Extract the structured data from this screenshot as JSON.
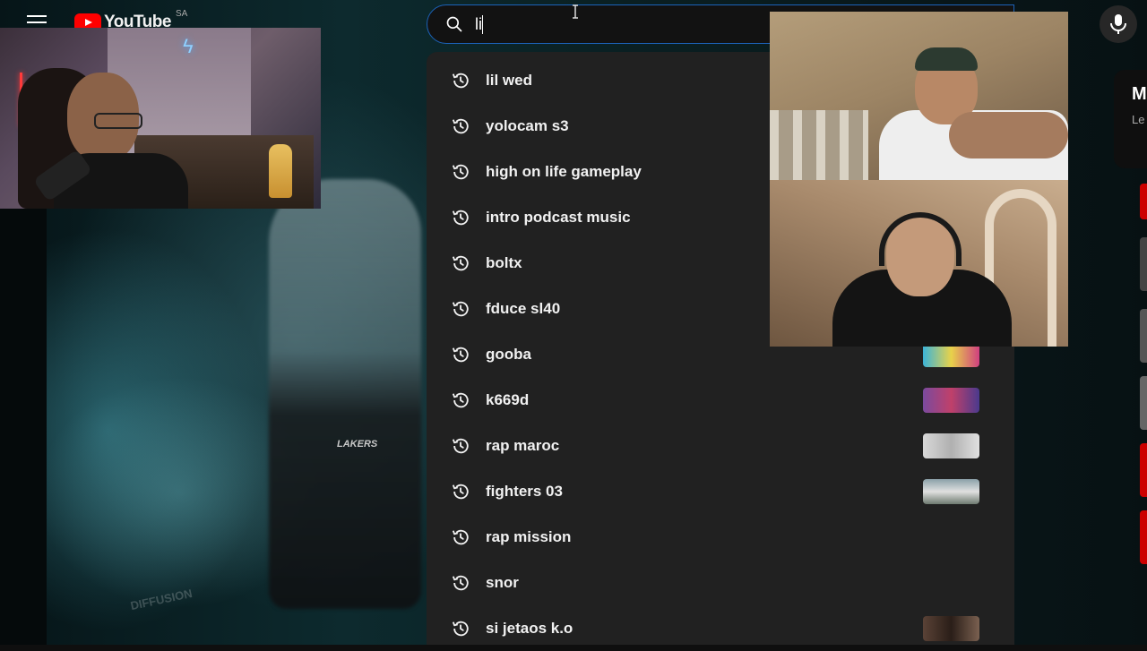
{
  "header": {
    "logo_text": "YouTube",
    "region": "SA",
    "menu_icon": "hamburger-icon"
  },
  "search": {
    "value": "li",
    "search_icon": "search-icon",
    "mic_icon": "microphone-icon"
  },
  "suggestions": [
    {
      "text": "lil wed",
      "thumb": false
    },
    {
      "text": "yolocam s3",
      "thumb": false
    },
    {
      "text": "high on life gameplay",
      "thumb": false
    },
    {
      "text": "intro podcast music",
      "thumb": false
    },
    {
      "text": "boltx",
      "thumb": false
    },
    {
      "text": "fduce sl40",
      "thumb": false
    },
    {
      "text": "gooba",
      "thumb": true
    },
    {
      "text": "k669d",
      "thumb": true
    },
    {
      "text": "rap maroc",
      "thumb": true
    },
    {
      "text": "fighters 03",
      "thumb": true
    },
    {
      "text": "rap mission",
      "thumb": false
    },
    {
      "text": "snor",
      "thumb": false
    },
    {
      "text": "si jetaos k.o",
      "thumb": true
    }
  ],
  "video": {
    "jersey_text": "LAKERS",
    "watermark": "DIFFUSION"
  },
  "right_panel": {
    "title": "M",
    "subtitle": "Le"
  },
  "colors": {
    "accent_blue": "#1c62b9",
    "brand_red": "#ff0000",
    "dropdown_bg": "#212121"
  }
}
